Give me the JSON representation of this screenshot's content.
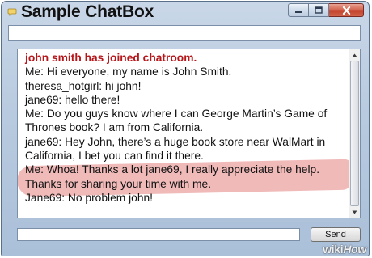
{
  "window": {
    "title": "Sample ChatBox",
    "controls": {
      "minimize_icon": "minimize-icon",
      "maximize_icon": "maximize-icon",
      "close_icon": "close-icon"
    }
  },
  "top_field": {
    "value": ""
  },
  "chat": {
    "messages": [
      {
        "text": "john smith has joined chatroom.",
        "kind": "system"
      },
      {
        "text": "Me: Hi everyone, my name is John Smith.",
        "kind": "normal"
      },
      {
        "text": "theresa_hotgirl: hi john!",
        "kind": "normal"
      },
      {
        "text": "jane69: hello there!",
        "kind": "normal"
      },
      {
        "text": "Me: Do you guys know where I can George Martin’s Game of",
        "kind": "normal"
      },
      {
        "text": "Thrones book? I am from California.",
        "kind": "normal"
      },
      {
        "text": "jane69: Hey John, there’s a huge book store near WalMart in",
        "kind": "normal"
      },
      {
        "text": "California, I bet you can find it there.",
        "kind": "normal"
      },
      {
        "text": "Me: Whoa! Thanks a lot jane69, I really appreciate the help.",
        "kind": "normal"
      },
      {
        "text": "Thanks for sharing your time with me.",
        "kind": "normal"
      },
      {
        "text": "Jane69: No problem john!",
        "kind": "normal"
      }
    ]
  },
  "compose": {
    "value": "",
    "send_label": "Send"
  },
  "watermark": {
    "wiki": "wiki",
    "how": "How"
  },
  "colors": {
    "system_message": "#b5171b",
    "highlight": "#e48280",
    "frame": "#b8cadf",
    "close_button": "#c0402a"
  }
}
